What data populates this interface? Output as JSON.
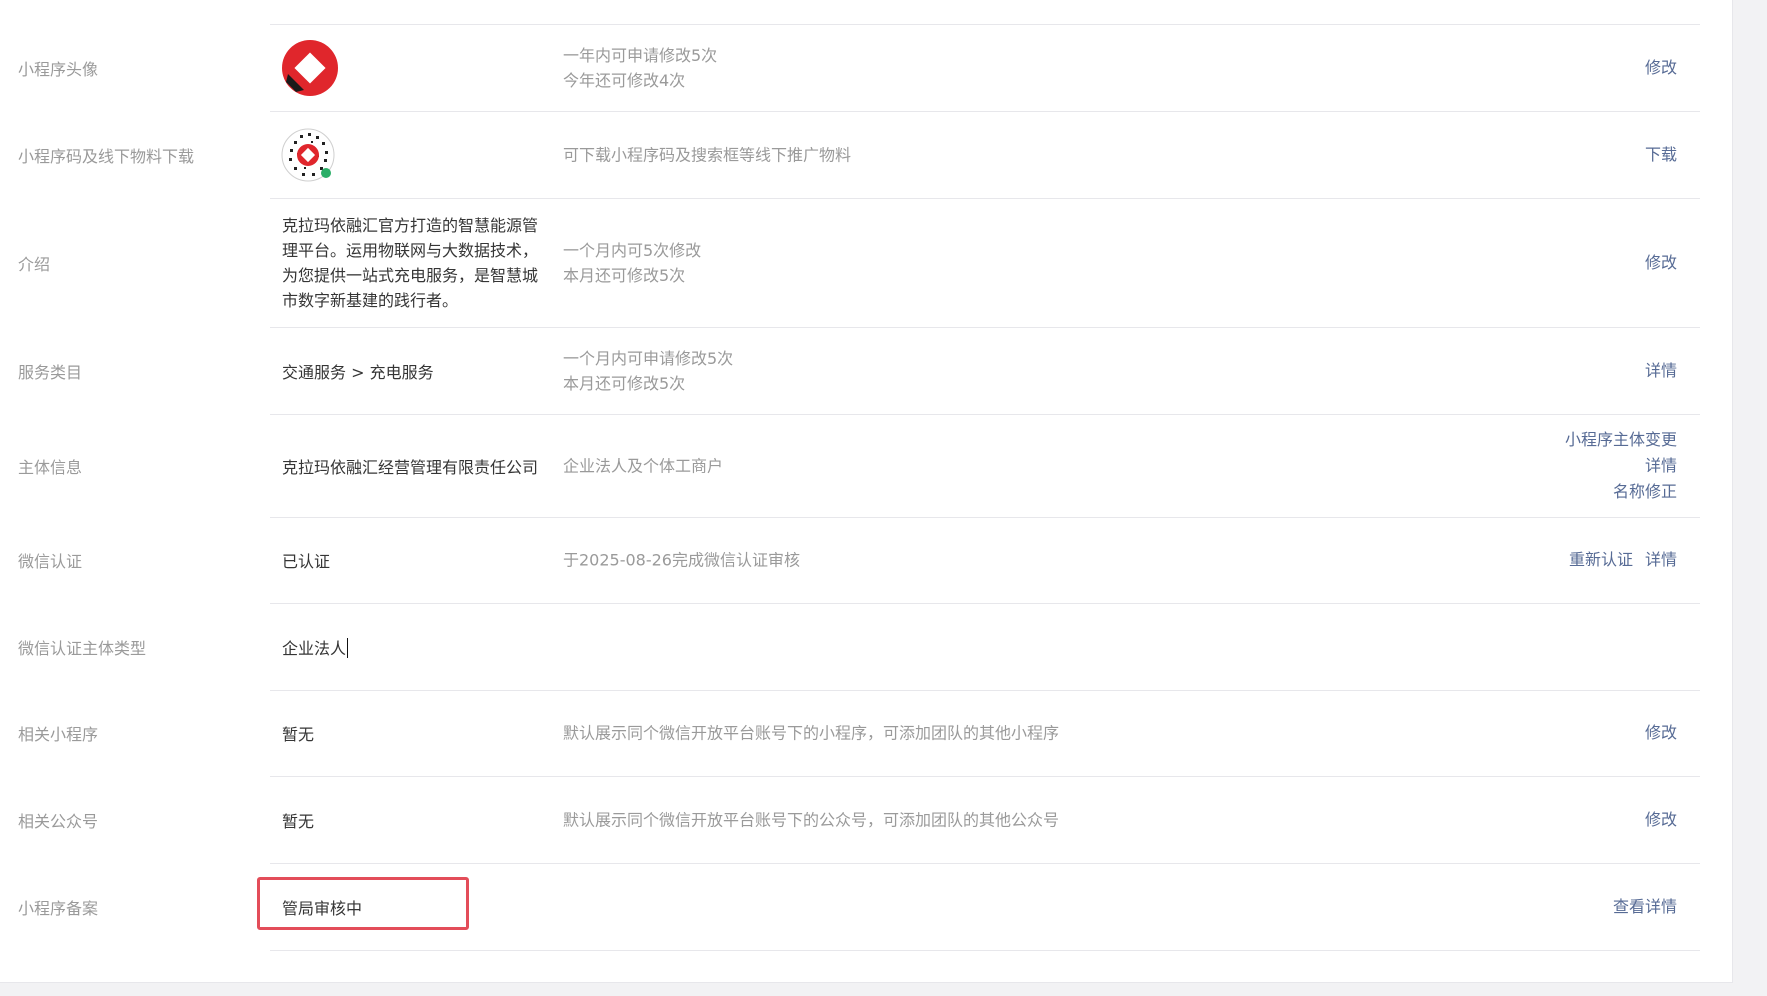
{
  "top_partial_text": "",
  "rows": {
    "avatar": {
      "label": "小程序头像",
      "desc_line1": "一年内可申请修改5次",
      "desc_line2": "今年还可修改4次",
      "action": "修改"
    },
    "qrcode": {
      "label": "小程序码及线下物料下载",
      "desc": "可下载小程序码及搜索框等线下推广物料",
      "action": "下载"
    },
    "intro": {
      "label": "介绍",
      "value": "克拉玛依融汇官方打造的智慧能源管理平台。运用物联网与大数据技术，为您提供一站式充电服务，是智慧城市数字新基建的践行者。",
      "desc_line1": "一个月内可5次修改",
      "desc_line2": "本月还可修改5次",
      "action": "修改"
    },
    "category": {
      "label": "服务类目",
      "value": "交通服务 > 充电服务",
      "desc_line1": "一个月内可申请修改5次",
      "desc_line2": "本月还可修改5次",
      "action": "详情"
    },
    "entity": {
      "label": "主体信息",
      "value": "克拉玛依融汇经营管理有限责任公司",
      "desc": "企业法人及个体工商户",
      "action1": "小程序主体变更",
      "action2": "详情",
      "action3": "名称修正"
    },
    "wechat_auth": {
      "label": "微信认证",
      "value": "已认证",
      "desc": "于2025-08-26完成微信认证审核",
      "action1": "重新认证",
      "action2": "详情"
    },
    "auth_type": {
      "label": "微信认证主体类型",
      "value": "企业法人"
    },
    "related_mini": {
      "label": "相关小程序",
      "value": "暂无",
      "desc": "默认展示同个微信开放平台账号下的小程序，可添加团队的其他小程序",
      "action": "修改"
    },
    "related_oa": {
      "label": "相关公众号",
      "value": "暂无",
      "desc": "默认展示同个微信开放平台账号下的公众号，可添加团队的其他公众号",
      "action": "修改"
    },
    "icp": {
      "label": "小程序备案",
      "value": "管局审核中",
      "action": "查看详情"
    }
  },
  "colors": {
    "link": "#576b95",
    "label": "#9a9a9a",
    "highlight": "#e34d59",
    "logo_red": "#e0262c"
  }
}
